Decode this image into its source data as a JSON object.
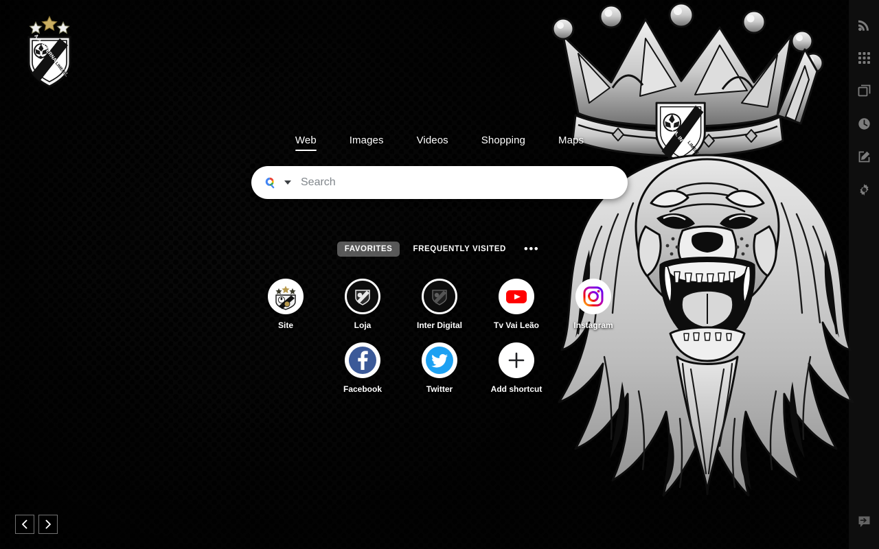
{
  "brand": {
    "logo_name": "aa-internacional-limeira-crest",
    "club_text_1": "A.A. INTERNACIONAL",
    "club_text_2": "LIMEIRA"
  },
  "colors": {
    "background": "#151515",
    "dot_pattern": "#050505",
    "accent_white": "#ffffff",
    "active_pill": "#969696",
    "youtube_red": "#ff0000",
    "facebook_blue": "#3b5998",
    "twitter_blue": "#1da1f2",
    "search_bg": "#ffffff",
    "placeholder": "#80868b"
  },
  "nav": {
    "tabs": [
      {
        "label": "Web",
        "active": true
      },
      {
        "label": "Images",
        "active": false
      },
      {
        "label": "Videos",
        "active": false
      },
      {
        "label": "Shopping",
        "active": false
      },
      {
        "label": "Maps",
        "active": false
      }
    ]
  },
  "search": {
    "placeholder": "Search",
    "value": "",
    "engine_icon": "google-search-icon",
    "dropdown_icon": "chevron-down-icon"
  },
  "shortcut_tabs": {
    "favorites": "FAVORITES",
    "frequently_visited": "FREQUENTLY VISITED",
    "more": "•••",
    "active": "FAVORITES"
  },
  "shortcuts": [
    {
      "label": "Site",
      "icon": "club-crest-icon",
      "style": "light"
    },
    {
      "label": "Loja",
      "icon": "club-crest-icon",
      "style": "dark"
    },
    {
      "label": "Inter Digital",
      "icon": "club-crest-icon",
      "style": "dark"
    },
    {
      "label": "Tv Vai Leão",
      "icon": "youtube-icon",
      "style": "light"
    },
    {
      "label": "Instagram",
      "icon": "instagram-icon",
      "style": "light"
    },
    {
      "label": "Facebook",
      "icon": "facebook-icon",
      "style": "light"
    },
    {
      "label": "Twitter",
      "icon": "twitter-icon",
      "style": "light"
    },
    {
      "label": "Add shortcut",
      "icon": "plus-icon",
      "style": "light"
    }
  ],
  "sidebar": {
    "items": [
      {
        "name": "rss-feed-icon",
        "label": "Feed"
      },
      {
        "name": "apps-grid-icon",
        "label": "Apps"
      },
      {
        "name": "snapshot-icon",
        "label": "Snapshot"
      },
      {
        "name": "clock-history-icon",
        "label": "History"
      },
      {
        "name": "edit-note-icon",
        "label": "Notes"
      },
      {
        "name": "gear-settings-icon",
        "label": "Settings"
      }
    ],
    "feedback": {
      "name": "feedback-bubble-icon",
      "label": "Feedback"
    }
  },
  "wallpaper_nav": {
    "previous": "‹",
    "next": "›"
  }
}
